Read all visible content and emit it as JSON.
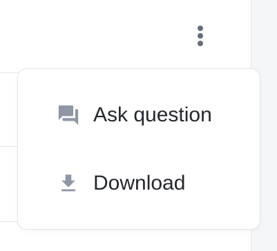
{
  "menu": {
    "items": [
      {
        "label": "Ask question",
        "icon": "question-answer-icon"
      },
      {
        "label": "Download",
        "icon": "download-icon"
      }
    ]
  },
  "colors": {
    "icon": "#8f97a6",
    "kebab": "#666d79",
    "text": "#23272e",
    "border": "#e3e6ea"
  }
}
